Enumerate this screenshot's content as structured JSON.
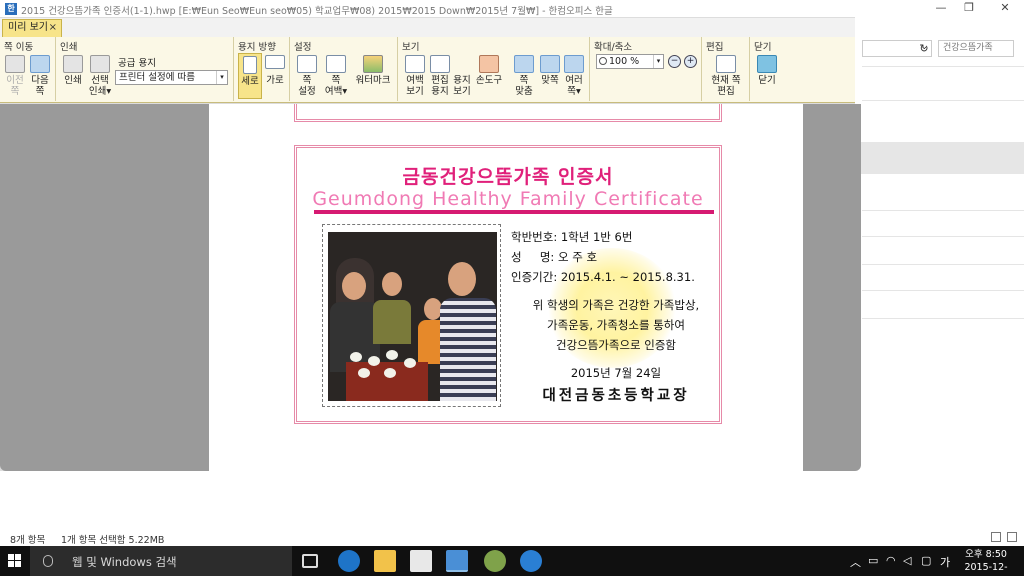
{
  "window": {
    "title": "2015 건강으뜸가족 인증서(1-1).hwp [E:₩Eun Seo₩Eun seo₩05) 학교업무₩08) 2015₩2015 Down₩2015년 7월₩] - 한컴오피스 한글",
    "tab_label": "미리 보기"
  },
  "ribbon": {
    "groups": {
      "page_move": "쪽 이동",
      "print": "인쇄",
      "paper_dir": "용지 방향",
      "settings": "설정",
      "view": "보기",
      "zoom": "확대/축소",
      "edit": "편집",
      "close": "닫기"
    },
    "buttons": {
      "prev": "이전\n쪽",
      "next": "다음\n쪽",
      "print": "인쇄",
      "print_sel": "선택\n인쇄▾",
      "portrait": "세로",
      "landscape": "가로",
      "page_setup": "쪽\n설정",
      "page_margin": "쪽\n여백▾",
      "watermark": "워터마크",
      "margin_view": "여백\n보기",
      "edit_paper": "편집\n용지",
      "paper_view": "용지\n보기",
      "hand_tool": "손도구",
      "fit_page": "쪽\n맞춤",
      "facing": "맞쪽",
      "multi": "여러\n쪽▾",
      "edit_current": "현재 쪽\n편집",
      "close": "닫기"
    },
    "paper_label": "공급 용지",
    "paper_value": "프린터 설정에 따름",
    "zoom_value": "100 %"
  },
  "certificate": {
    "title_ko": "금동건강으뜸가족 인증서",
    "title_en": "Geumdong Healthy Family Certificate",
    "class_row": "학반번호: 1학년 1반 6번",
    "name_row": "성     명: 오 주 호",
    "period_row": "인증기간: 2015.4.1. ~ 2015.8.31.",
    "msg1": "위 학생의 가족은 건강한 가족밥상,",
    "msg2": "가족운동, 가족청소를 통하여",
    "msg3": "건강으뜸가족으로 인증함",
    "date": "2015년 7월 24일",
    "school": "대전금동초등학교장"
  },
  "statusbar": {
    "items": "8개 항목",
    "selection": "1개 항목 선택함 5.22MB"
  },
  "background_window": {
    "search_placeholder": "건강으뜸가족"
  },
  "taskbar": {
    "search_placeholder": "웹 및 Windows 검색",
    "time": "오후 8:50",
    "date": "2015-12-07",
    "ime": "가"
  },
  "colors": {
    "accent_pink": "#e0207a",
    "ribbon_bg": "#fbf8e6",
    "tab_yellow": "#f7e48a"
  }
}
